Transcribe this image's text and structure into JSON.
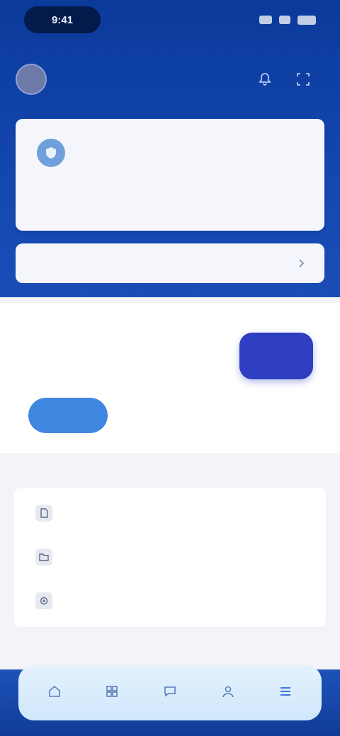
{
  "status_bar": {
    "time": "9:41"
  },
  "profile": {
    "name": "",
    "subtitle": "",
    "avatar_initial": ""
  },
  "top_card": {
    "title": "",
    "subtitle": "",
    "footer": ""
  },
  "search": {
    "text": ""
  },
  "promo": {
    "kicker": "",
    "title": "",
    "description": "",
    "button_label": ""
  },
  "section_title": "",
  "list_items": [
    {
      "label": "",
      "icon": "document-icon"
    },
    {
      "label": "",
      "icon": "folder-icon"
    },
    {
      "label": "",
      "icon": "settings-icon"
    }
  ],
  "section_title_2": "",
  "tabs": [
    {
      "label": "",
      "icon": "home-icon"
    },
    {
      "label": "",
      "icon": "grid-icon"
    },
    {
      "label": "",
      "icon": "chat-icon"
    },
    {
      "label": "",
      "icon": "user-icon"
    },
    {
      "label": "",
      "icon": "menu-icon"
    }
  ],
  "active_tab_index": 4,
  "colors": {
    "primary": "#1447b0",
    "accent": "#3f86e0",
    "promo_tile": "#2d3fc0"
  }
}
